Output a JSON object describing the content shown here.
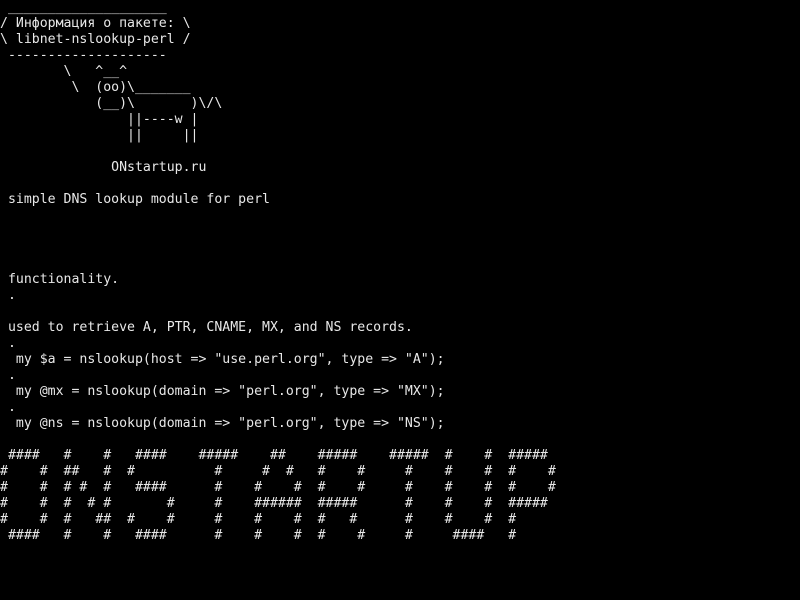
{
  "terminal": {
    "lines": [
      " ____________________",
      "/ Информация о пакете: \\",
      "\\ libnet-nslookup-perl /",
      " --------------------",
      "        \\   ^__^",
      "         \\  (oo)\\_______",
      "            (__)\\       )\\/\\",
      "                ||----w |",
      "                ||     ||",
      "",
      "              ONstartup.ru",
      "",
      " simple DNS lookup module for perl",
      "",
      "",
      "",
      "",
      " functionality.",
      " .",
      "",
      " used to retrieve A, PTR, CNAME, MX, and NS records.",
      " .",
      "  my $a = nslookup(host => \"use.perl.org\", type => \"A\");",
      " .",
      "  my @mx = nslookup(domain => \"perl.org\", type => \"MX\");",
      " .",
      "  my @ns = nslookup(domain => \"perl.org\", type => \"NS\");",
      "",
      " ####   #    #   ####    #####    ##    #####    #####  #    #  #####",
      "#    #  ##   #  #          #     #  #   #    #     #    #    #  #    #",
      "#    #  # #  #   ####      #    #    #  #    #     #    #    #  #    #",
      "#    #  #  # #       #     #    ######  #####      #    #    #  #####",
      "#    #  #   ##  #    #     #    #    #  #   #      #    #    #  #",
      " ####   #    #   ####      #    #    #  #    #     #     ####   #"
    ]
  }
}
